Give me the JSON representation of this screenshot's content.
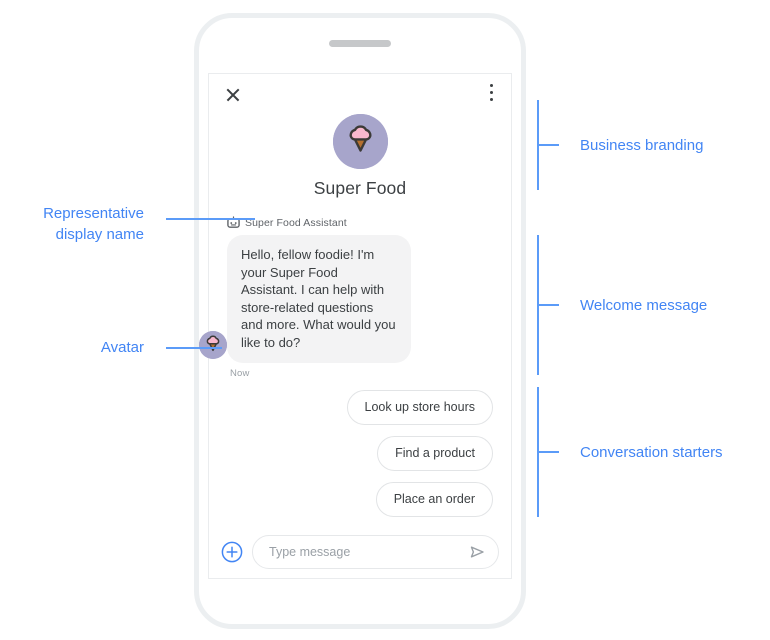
{
  "phone": {
    "speaker_name": "speaker-grille"
  },
  "chat": {
    "close_label": "close-icon",
    "menu_label": "overflow-menu-icon",
    "business_name": "Super Food",
    "representative_name": "Super Food Assistant",
    "representative_icon": "smart-toy-robot-icon",
    "logo_icon": "ice-cream-cone-logo",
    "avatar_icon": "ice-cream-cone-avatar",
    "welcome_message": "Hello, fellow foodie! I'm your Super Food Assistant. I can help with store-related questions and more. What would you like to do?",
    "timestamp": "Now",
    "conversation_starters": [
      "Look up store hours",
      "Find a product",
      "Place an order"
    ],
    "composer": {
      "add_icon": "plus-circle-icon",
      "placeholder": "Type message",
      "value": "",
      "send_icon": "send-arrow-icon"
    }
  },
  "annotations": {
    "left": [
      {
        "text": "Representative\ndisplay name",
        "name": "annotation-representative-display-name"
      },
      {
        "text": "Avatar",
        "name": "annotation-avatar"
      }
    ],
    "right": [
      {
        "text": "Business branding",
        "name": "annotation-business-branding"
      },
      {
        "text": "Welcome message",
        "name": "annotation-welcome-message"
      },
      {
        "text": "Conversation starters",
        "name": "annotation-conversation-starters"
      }
    ]
  },
  "colors": {
    "accent": "#4285f4",
    "connector": "#5b9bf8",
    "logo_circle": "#a7a5cb",
    "scoop": "#f9b8cd",
    "cone": "#b5702f",
    "bubble": "#f3f3f4",
    "text": "#3c4043",
    "muted": "#9aa0a6"
  }
}
